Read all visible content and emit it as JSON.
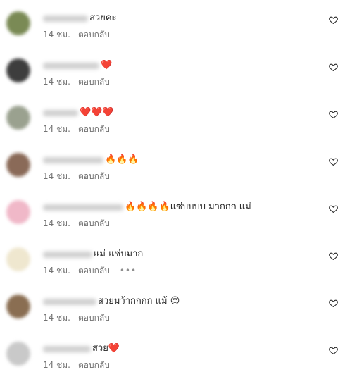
{
  "colors": {
    "text": "#262626",
    "meta": "#737373",
    "heart": "#e0245e"
  },
  "comments": [
    {
      "text": "สวยคะ",
      "time": "14 ชม.",
      "reply": "ตอบกลับ",
      "avatar": "#7a8a55",
      "name_w": 64,
      "more": ""
    },
    {
      "text": "❤️",
      "time": "14 ชม.",
      "reply": "ตอบกลับ",
      "avatar": "#3d3d3d",
      "name_w": 80,
      "more": ""
    },
    {
      "text": "❤️❤️❤️",
      "time": "14 ชม.",
      "reply": "ตอบกลับ",
      "avatar": "#9aa18f",
      "name_w": 50,
      "more": ""
    },
    {
      "text": "🔥🔥🔥",
      "time": "14 ชม.",
      "reply": "ตอบกลับ",
      "avatar": "#8a6a58",
      "name_w": 86,
      "more": ""
    },
    {
      "text": "🔥🔥🔥🔥แซ่บบบบ มากกก แม่",
      "time": "14 ชม.",
      "reply": "ตอบกลับ",
      "avatar": "#f0b8c8",
      "name_w": 114,
      "more": ""
    },
    {
      "text": "แม่ แซ่บมาก",
      "time": "14 ชม.",
      "reply": "ตอบกลับ",
      "avatar": "#efe7cf",
      "name_w": 70,
      "more": "•••"
    },
    {
      "text": "สวยมว้ากกกก แม้ 😍",
      "time": "14 ชม.",
      "reply": "ตอบกลับ",
      "avatar": "#8a6e52",
      "name_w": 76,
      "more": ""
    },
    {
      "text": "สวย❤️",
      "time": "14 ชม.",
      "reply": "ตอบกลับ",
      "avatar": "#c9c9c9",
      "name_w": 68,
      "more": ""
    }
  ]
}
